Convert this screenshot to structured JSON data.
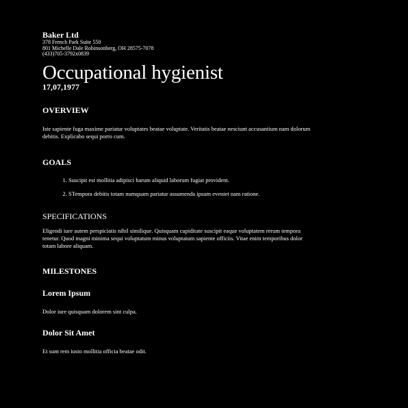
{
  "company": {
    "name": "Baker Ltd",
    "address_line1": "378 French Park Suite 550",
    "address_line2": "801 Michelle Dale Robinsonberg, OH 28575-7078",
    "phone": "(433)705-3792x0839"
  },
  "document": {
    "title": "Occupational hygienist",
    "date": "17,07,1977"
  },
  "overview": {
    "heading": "OVERVIEW",
    "text": "Iste sapiente fuga maxime pariatur voluptates beatae voluptate. Veritatis beatae nesciunt accusantium nam dolorum debitis. Explicabo sequi porro cum."
  },
  "goals": {
    "heading": "GOALS",
    "items": [
      "Suscipit est mollitia adipisci harum aliquid laborum fugiat provident.",
      "STempora debitis totam numquam pariatur assumenda ipsum eveniet nam ratione."
    ]
  },
  "specifications": {
    "heading": "SPECIFICATIONS",
    "text": "Eligendi iure autem perspiciatis nihil similique. Quisquam cupiditate suscipit eaque voluptatem rerum tempora tenetur. Quod magni minima sequi voluptatum minus voluptatum sapiente officiis. Vitae enim temporibus dolor totam labore aliquam."
  },
  "milestones": {
    "heading": "MILESTONES",
    "items": [
      {
        "title": "Lorem Ipsum",
        "text": "Dolor iure quisquam dolorem sint culpa."
      },
      {
        "title": "Dolor Sit Amet",
        "text": "Et sunt rem iusto mollitia officia beatae odit."
      }
    ]
  }
}
